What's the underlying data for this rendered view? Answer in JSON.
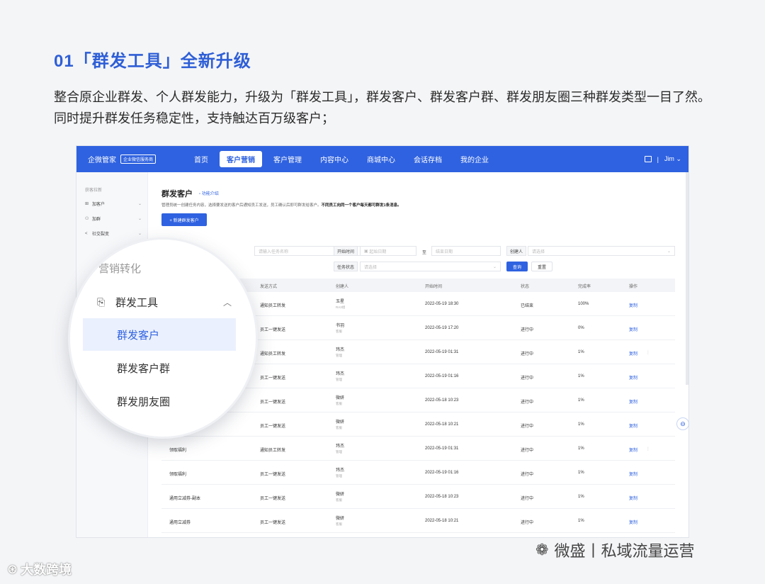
{
  "heading": "01「群发工具」全新升级",
  "intro": "整合原企业群发、个人群发能力，升级为「群发工具」，群发客户、群发客户群、群发朋友圈三种群发类型一目了然。同时提升群发任务稳定性，支持触达百万级客户；",
  "app": {
    "brand": "企微管家",
    "brand_badge": "企业微信服务商",
    "nav": [
      "首页",
      "客户营销",
      "客户管理",
      "内容中心",
      "商城中心",
      "会话存档",
      "我的企业"
    ],
    "user": "Jim"
  },
  "sidebar": {
    "group": "获客拉新",
    "items": [
      "加客户",
      "加群",
      "社交裂变"
    ]
  },
  "page": {
    "title": "群发客户",
    "func_link": "功能介绍",
    "desc": "管理员统一创建任务内容，选择要发送的客户后通知员工发送，员工确认后即可群发给客户。",
    "desc_bold": "不同员工向同一个客户每天都可群发1条消息。",
    "new_button": "+ 新建群发客户"
  },
  "filters": {
    "task_placeholder": "请输入任务名称",
    "start_label": "开始时间",
    "start_placeholder": "起始日期",
    "to": "至",
    "end_placeholder": "结束日期",
    "creator_label": "创建人",
    "creator_placeholder": "请选择",
    "status_label": "任务状态",
    "status_placeholder": "请选择",
    "query": "查询",
    "reset": "重置"
  },
  "table": {
    "columns": [
      "发送方式",
      "创建人",
      "开始时间",
      "状态",
      "完成率",
      "操作"
    ],
    "rows": [
      {
        "name": "",
        "method": "通知员工转发",
        "creator": "玉星",
        "dept": "RA3组",
        "time": "2022-05-19 18:30",
        "status": "已结束",
        "rate": "100%",
        "op": "复制"
      },
      {
        "name": "",
        "method": "员工一键发送",
        "creator": "书羽",
        "dept": "客服",
        "time": "2022-05-19 17:20",
        "status": "进行中",
        "rate": "0%",
        "op": "复制"
      },
      {
        "name": "",
        "method": "通知员工转发",
        "creator": "玮杰",
        "dept": "管理",
        "time": "2022-05-19 01:31",
        "status": "进行中",
        "rate": "1%",
        "op": "复制"
      },
      {
        "name": "",
        "method": "员工一键发送",
        "creator": "玮杰",
        "dept": "管理",
        "time": "2022-05-19 01:16",
        "status": "进行中",
        "rate": "1%",
        "op": "复制"
      },
      {
        "name": "",
        "method": "员工一键发送",
        "creator": "微妍",
        "dept": "客服",
        "time": "2022-05-18 10:23",
        "status": "进行中",
        "rate": "1%",
        "op": "复制"
      },
      {
        "name": "",
        "method": "员工一键发送",
        "creator": "微妍",
        "dept": "客服",
        "time": "2022-05-18 10:21",
        "status": "进行中",
        "rate": "1%",
        "op": "复制"
      },
      {
        "name": "领取福利",
        "method": "通知员工转发",
        "creator": "玮杰",
        "dept": "管理",
        "time": "2022-05-19 01:31",
        "status": "进行中",
        "rate": "1%",
        "op": "复制"
      },
      {
        "name": "领取福利",
        "method": "员工一键发送",
        "creator": "玮杰",
        "dept": "管理",
        "time": "2022-05-19 01:16",
        "status": "进行中",
        "rate": "1%",
        "op": "复制"
      },
      {
        "name": "通用立减券-副本",
        "method": "员工一键发送",
        "creator": "微妍",
        "dept": "客服",
        "time": "2022-05-18 10:23",
        "status": "进行中",
        "rate": "1%",
        "op": "复制"
      },
      {
        "name": "通用立减券",
        "method": "员工一键发送",
        "creator": "微妍",
        "dept": "客服",
        "time": "2022-05-18 10:21",
        "status": "进行中",
        "rate": "1%",
        "op": "复制"
      }
    ]
  },
  "magnifier": {
    "group": "营销转化",
    "parent": "群发工具",
    "items": [
      "群发客户",
      "群发客户群",
      "群发朋友圈"
    ]
  },
  "watermark_right": "微盛丨私域流量运营",
  "watermark_left": "大数跨境",
  "colors": {
    "accent": "#2f62e0",
    "heading": "#2f5fd6"
  }
}
